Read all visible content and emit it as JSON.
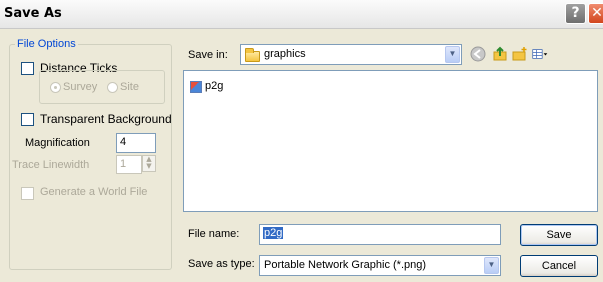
{
  "window": {
    "title": "Save As",
    "help_glyph": "?",
    "close_glyph": "✕"
  },
  "file_options": {
    "legend": "File Options",
    "distance_ticks": {
      "label": "Distance Ticks",
      "checked": false
    },
    "tick_mode": {
      "options": [
        "Survey",
        "Site"
      ],
      "selected": "Survey"
    },
    "transparent_background": {
      "label": "Transparent Background",
      "checked": false
    },
    "magnification": {
      "label": "Magnification",
      "value": "4"
    },
    "trace_linewidth": {
      "label": "Trace Linewidth",
      "value": "1"
    },
    "generate_world_file": {
      "label": "Generate a World File",
      "checked": false
    }
  },
  "save_in": {
    "label": "Save in:",
    "value": "graphics",
    "toolbar_icons": [
      "back-icon",
      "up-folder-icon",
      "new-folder-icon",
      "view-menu-icon"
    ]
  },
  "files": [
    {
      "name": "p2g",
      "icon": "file-icon"
    }
  ],
  "file_name": {
    "label": "File name:",
    "value": "p2g"
  },
  "save_as_type": {
    "label": "Save as type:",
    "value": "Portable Network Graphic (*.png)"
  },
  "buttons": {
    "save": "Save",
    "cancel": "Cancel"
  }
}
